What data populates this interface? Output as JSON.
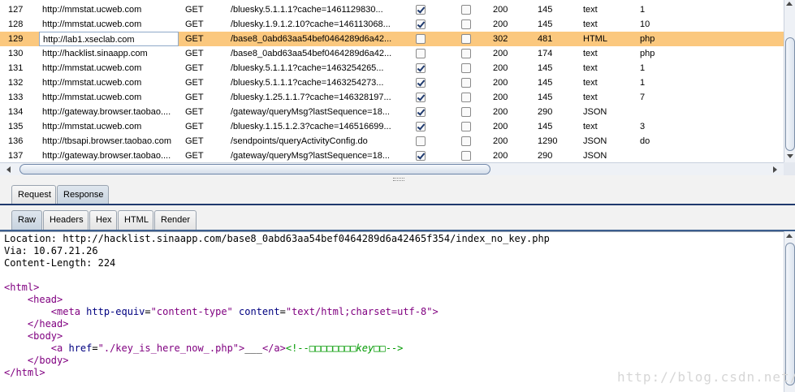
{
  "history": {
    "rows": [
      {
        "num": "127",
        "host": "http://mmstat.ucweb.com",
        "method": "GET",
        "url": "/bluesky.5.1.1.1?cache=1461129830...",
        "params": true,
        "edited": false,
        "status": "200",
        "length": "145",
        "mime": "text",
        "ext": "1",
        "selected": false
      },
      {
        "num": "128",
        "host": "http://mmstat.ucweb.com",
        "method": "GET",
        "url": "/bluesky.1.9.1.2.10?cache=146113068...",
        "params": true,
        "edited": false,
        "status": "200",
        "length": "145",
        "mime": "text",
        "ext": "10",
        "selected": false
      },
      {
        "num": "129",
        "host": "http://lab1.xseclab.com",
        "method": "GET",
        "url": "/base8_0abd63aa54bef0464289d6a42...",
        "params": false,
        "edited": false,
        "status": "302",
        "length": "481",
        "mime": "HTML",
        "ext": "php",
        "selected": true
      },
      {
        "num": "130",
        "host": "http://hacklist.sinaapp.com",
        "method": "GET",
        "url": "/base8_0abd63aa54bef0464289d6a42...",
        "params": false,
        "edited": false,
        "status": "200",
        "length": "174",
        "mime": "text",
        "ext": "php",
        "selected": false
      },
      {
        "num": "131",
        "host": "http://mmstat.ucweb.com",
        "method": "GET",
        "url": "/bluesky.5.1.1.1?cache=1463254265...",
        "params": true,
        "edited": false,
        "status": "200",
        "length": "145",
        "mime": "text",
        "ext": "1",
        "selected": false
      },
      {
        "num": "132",
        "host": "http://mmstat.ucweb.com",
        "method": "GET",
        "url": "/bluesky.5.1.1.1?cache=1463254273...",
        "params": true,
        "edited": false,
        "status": "200",
        "length": "145",
        "mime": "text",
        "ext": "1",
        "selected": false
      },
      {
        "num": "133",
        "host": "http://mmstat.ucweb.com",
        "method": "GET",
        "url": "/bluesky.1.25.1.1.7?cache=146328197...",
        "params": true,
        "edited": false,
        "status": "200",
        "length": "145",
        "mime": "text",
        "ext": "7",
        "selected": false
      },
      {
        "num": "134",
        "host": "http://gateway.browser.taobao....",
        "method": "GET",
        "url": "/gateway/queryMsg?lastSequence=18...",
        "params": true,
        "edited": false,
        "status": "200",
        "length": "290",
        "mime": "JSON",
        "ext": "",
        "selected": false
      },
      {
        "num": "135",
        "host": "http://mmstat.ucweb.com",
        "method": "GET",
        "url": "/bluesky.1.15.1.2.3?cache=146516699...",
        "params": true,
        "edited": false,
        "status": "200",
        "length": "145",
        "mime": "text",
        "ext": "3",
        "selected": false
      },
      {
        "num": "136",
        "host": "http://tbsapi.browser.taobao.com",
        "method": "GET",
        "url": "/sendpoints/queryActivityConfig.do",
        "params": false,
        "edited": false,
        "status": "200",
        "length": "1290",
        "mime": "JSON",
        "ext": "do",
        "selected": false
      },
      {
        "num": "137",
        "host": "http://gateway.browser.taobao....",
        "method": "GET",
        "url": "/gateway/queryMsg?lastSequence=18...",
        "params": true,
        "edited": false,
        "status": "200",
        "length": "290",
        "mime": "JSON",
        "ext": "",
        "selected": false
      }
    ]
  },
  "outer_tabs": {
    "request": "Request",
    "response": "Response",
    "active": "response"
  },
  "inner_tabs": {
    "raw": "Raw",
    "headers": "Headers",
    "hex": "Hex",
    "html": "HTML",
    "render": "Render",
    "active": "raw"
  },
  "response": {
    "headers": [
      "Location: http://hacklist.sinaapp.com/base8_0abd63aa54bef0464289d6a42465f354/index_no_key.php",
      "Via: 10.67.21.26",
      "Content-Length: 224"
    ],
    "html": {
      "html_open": "<html>",
      "head_open": "<head>",
      "meta_tag_name": "<meta",
      "meta_attr1": "http-equiv",
      "meta_val1": "\"content-type\"",
      "meta_attr2": "content",
      "meta_val2": "\"text/html;charset=utf-8\"",
      "meta_close": ">",
      "head_close": "</head>",
      "body_open": "<body>",
      "a_open": "<a",
      "a_attr": "href",
      "a_val": "\"./key_is_here_now_.php\"",
      "a_gt": ">",
      "a_text": "___",
      "a_close": "</a>",
      "comment_start": "<!--",
      "comment_boxes": "□□□□□□□□",
      "comment_key": "key",
      "comment_boxes2": "□□",
      "comment_end": "-->",
      "body_close": "</body>",
      "html_close": "</html>"
    }
  },
  "watermark": "http://blog.csdn.net/"
}
